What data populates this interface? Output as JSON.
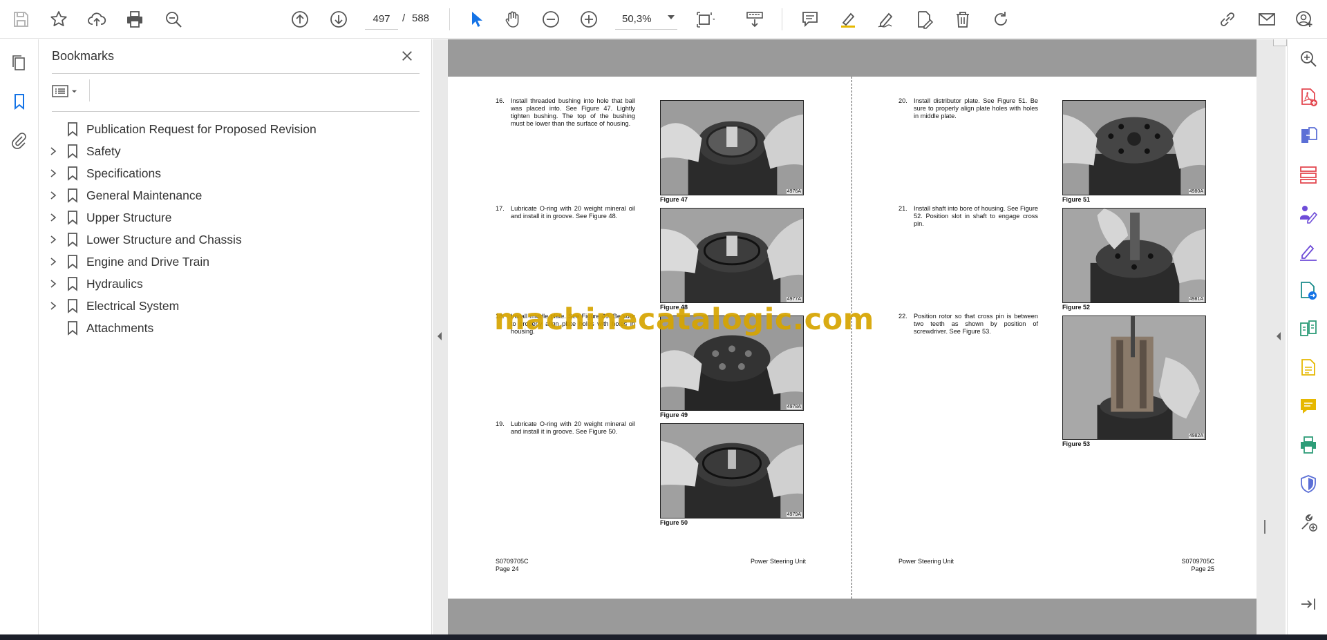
{
  "toolbar": {
    "current_page": "497",
    "separator": "/",
    "total_pages": "588",
    "zoom": "50,3%",
    "icons": [
      "save-icon",
      "bookmark-star-icon",
      "upload-icon",
      "print-icon",
      "find-zoom-icon",
      "prev-page-icon",
      "next-page-icon",
      "select-pointer-icon",
      "hand-tool-icon",
      "zoom-out-icon",
      "zoom-in-icon",
      "page-fit-icon",
      "scroll-mode-icon",
      "comment-icon",
      "highlight-icon",
      "draw-icon",
      "edit-text-icon",
      "delete-icon",
      "rotate-icon",
      "share-link-icon",
      "mail-icon",
      "account-icon"
    ]
  },
  "bookmarks": {
    "title": "Bookmarks",
    "items": [
      {
        "label": "Publication Request for Proposed Revision",
        "expandable": false
      },
      {
        "label": "Safety",
        "expandable": true
      },
      {
        "label": "Specifications",
        "expandable": true
      },
      {
        "label": "General Maintenance",
        "expandable": true
      },
      {
        "label": "Upper Structure",
        "expandable": true
      },
      {
        "label": "Lower Structure and Chassis",
        "expandable": true
      },
      {
        "label": "Engine and Drive Train",
        "expandable": true
      },
      {
        "label": "Hydraulics",
        "expandable": true
      },
      {
        "label": "Electrical System",
        "expandable": true
      },
      {
        "label": "Attachments",
        "expandable": false
      }
    ]
  },
  "document": {
    "left_page": {
      "steps": [
        {
          "num": "16.",
          "text": "Install threaded bushing into hole that ball was placed into. See Figure 47. Lightly tighten bushing. The top of the bushing must be lower than the surface of housing."
        },
        {
          "num": "17.",
          "text": "Lubricate O-ring with 20 weight mineral oil and install it in groove. See Figure 48."
        },
        {
          "num": "18.",
          "text": "Install middle plate. See Figure 49. Be sure to properly align plate holes with holes in housing."
        },
        {
          "num": "19.",
          "text": "Lubricate O-ring with 20 weight mineral oil and install it in groove. See Figure 50."
        }
      ],
      "figures": [
        {
          "caption": "Figure 47",
          "code": "4976A"
        },
        {
          "caption": "Figure 48",
          "code": "4977A"
        },
        {
          "caption": "Figure 49",
          "code": "4978A"
        },
        {
          "caption": "Figure 50",
          "code": "4979A"
        }
      ],
      "footer_left_1": "S0709705C",
      "footer_left_2": "Page 24",
      "footer_right": "Power Steering Unit"
    },
    "right_page": {
      "steps": [
        {
          "num": "20.",
          "text": "Install distributor plate. See Figure 51. Be sure to properly align plate holes with holes in middle plate."
        },
        {
          "num": "21.",
          "text": "Install shaft into bore of housing. See Figure 52. Position slot in shaft to engage cross pin."
        },
        {
          "num": "22.",
          "text": "Position rotor so that cross pin is between two teeth as shown by position of screwdriver. See Figure 53."
        }
      ],
      "figures": [
        {
          "caption": "Figure 51",
          "code": "4980A"
        },
        {
          "caption": "Figure 52",
          "code": "4981A"
        },
        {
          "caption": "Figure 53",
          "code": "4982A"
        }
      ],
      "footer_left": "Power Steering Unit",
      "footer_right_1": "S0709705C",
      "footer_right_2": "Page 25"
    },
    "watermark": "machinecatalogic.com"
  },
  "colors": {
    "accent_blue": "#1473e6",
    "purple": "#6e4cd8",
    "red": "#e34850",
    "green": "#2d9d78",
    "yellow": "#e6b800",
    "watermark": "#d6a400"
  }
}
